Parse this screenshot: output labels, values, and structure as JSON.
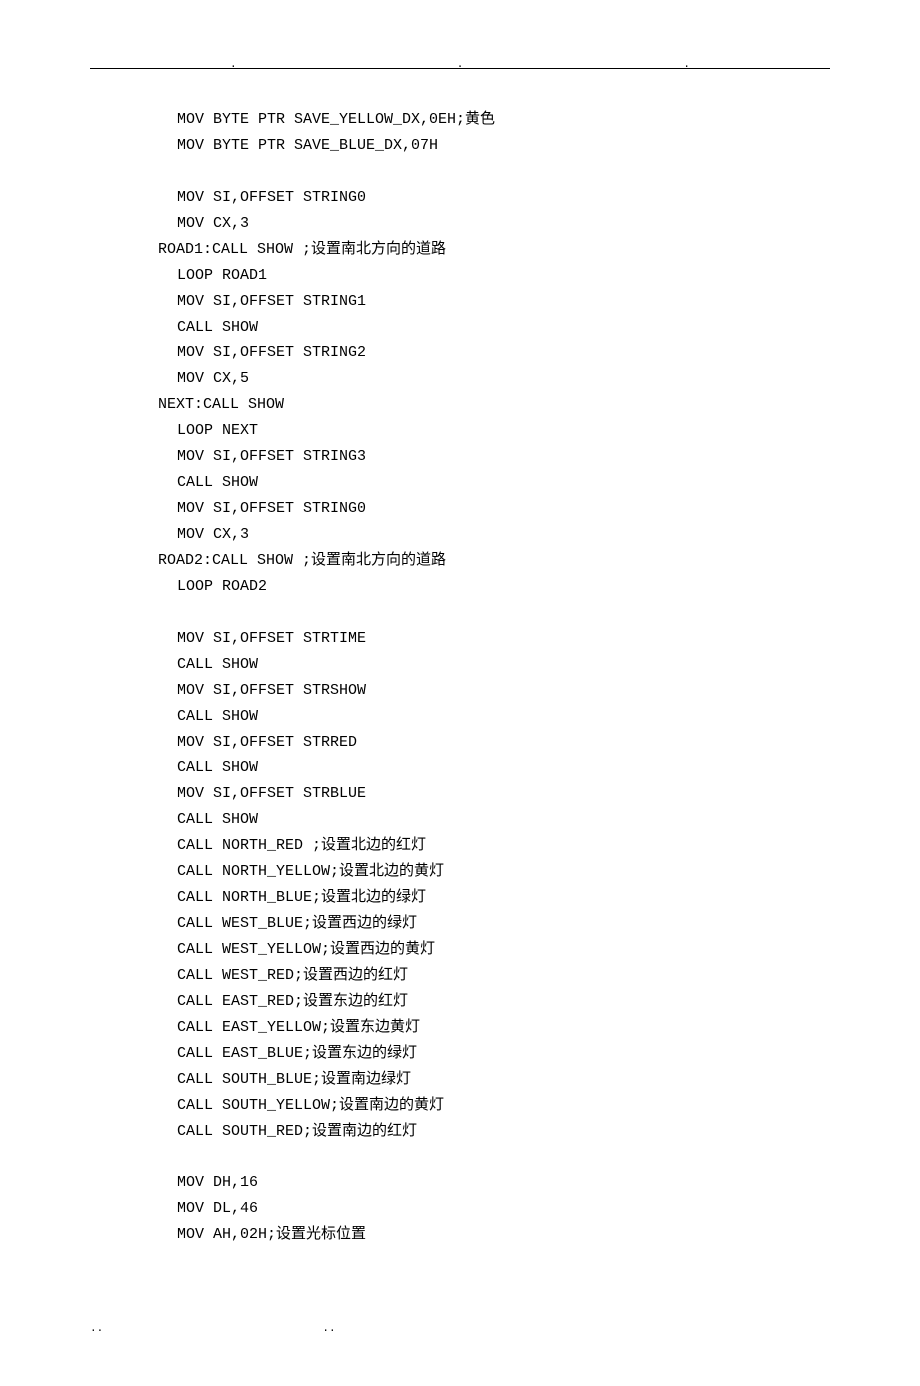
{
  "header": {
    "dot": "."
  },
  "code": {
    "lines": [
      {
        "class": "code-line",
        "text": " MOV BYTE PTR SAVE_YELLOW_DX,0EH;黄色"
      },
      {
        "class": "code-line",
        "text": " MOV BYTE PTR SAVE_BLUE_DX,07H"
      },
      {
        "class": "code-line blank",
        "text": ""
      },
      {
        "class": "code-line",
        "text": " MOV SI,OFFSET STRING0"
      },
      {
        "class": "code-line",
        "text": " MOV CX,3"
      },
      {
        "class": "code-line label",
        "text": "ROAD1:CALL SHOW ;设置南北方向的道路"
      },
      {
        "class": "code-line",
        "text": " LOOP ROAD1"
      },
      {
        "class": "code-line",
        "text": " MOV SI,OFFSET STRING1"
      },
      {
        "class": "code-line",
        "text": " CALL SHOW"
      },
      {
        "class": "code-line",
        "text": " MOV SI,OFFSET STRING2"
      },
      {
        "class": "code-line",
        "text": " MOV CX,5"
      },
      {
        "class": "code-line label",
        "text": "NEXT:CALL SHOW"
      },
      {
        "class": "code-line",
        "text": " LOOP NEXT"
      },
      {
        "class": "code-line",
        "text": " MOV SI,OFFSET STRING3"
      },
      {
        "class": "code-line",
        "text": " CALL SHOW"
      },
      {
        "class": "code-line",
        "text": " MOV SI,OFFSET STRING0"
      },
      {
        "class": "code-line",
        "text": " MOV CX,3"
      },
      {
        "class": "code-line label",
        "text": "ROAD2:CALL SHOW ;设置南北方向的道路"
      },
      {
        "class": "code-line",
        "text": " LOOP ROAD2"
      },
      {
        "class": "code-line blank",
        "text": ""
      },
      {
        "class": "code-line",
        "text": " MOV SI,OFFSET STRTIME"
      },
      {
        "class": "code-line",
        "text": " CALL SHOW"
      },
      {
        "class": "code-line",
        "text": " MOV SI,OFFSET STRSHOW"
      },
      {
        "class": "code-line",
        "text": " CALL SHOW"
      },
      {
        "class": "code-line",
        "text": " MOV SI,OFFSET STRRED"
      },
      {
        "class": "code-line",
        "text": " CALL SHOW"
      },
      {
        "class": "code-line",
        "text": " MOV SI,OFFSET STRBLUE"
      },
      {
        "class": "code-line",
        "text": " CALL SHOW"
      },
      {
        "class": "code-line",
        "text": " CALL NORTH_RED ;设置北边的红灯"
      },
      {
        "class": "code-line",
        "text": " CALL NORTH_YELLOW;设置北边的黄灯"
      },
      {
        "class": "code-line",
        "text": " CALL NORTH_BLUE;设置北边的绿灯"
      },
      {
        "class": "code-line",
        "text": " CALL WEST_BLUE;设置西边的绿灯"
      },
      {
        "class": "code-line",
        "text": " CALL WEST_YELLOW;设置西边的黄灯"
      },
      {
        "class": "code-line",
        "text": " CALL WEST_RED;设置西边的红灯"
      },
      {
        "class": "code-line",
        "text": " CALL EAST_RED;设置东边的红灯"
      },
      {
        "class": "code-line",
        "text": " CALL EAST_YELLOW;设置东边黄灯"
      },
      {
        "class": "code-line",
        "text": " CALL EAST_BLUE;设置东边的绿灯"
      },
      {
        "class": "code-line",
        "text": " CALL SOUTH_BLUE;设置南边绿灯"
      },
      {
        "class": "code-line",
        "text": " CALL SOUTH_YELLOW;设置南边的黄灯"
      },
      {
        "class": "code-line",
        "text": " CALL SOUTH_RED;设置南边的红灯"
      },
      {
        "class": "code-line blank",
        "text": ""
      },
      {
        "class": "code-line",
        "text": " MOV DH,16"
      },
      {
        "class": "code-line",
        "text": " MOV DL,46"
      },
      {
        "class": "code-line",
        "text": " MOV AH,02H;设置光标位置"
      }
    ]
  },
  "footer": {
    "dot": ".."
  }
}
